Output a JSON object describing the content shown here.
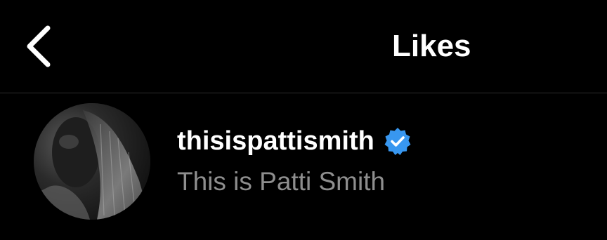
{
  "header": {
    "back_icon": "chevron-left-icon",
    "title": "Likes"
  },
  "likes": [
    {
      "username": "thisispattismith",
      "full_name": "This is Patti Smith",
      "verified": true,
      "verified_icon": "verified-badge-icon",
      "avatar": "avatar-photo"
    }
  ],
  "colors": {
    "background": "#000000",
    "primary_text": "#ffffff",
    "secondary_text": "#8e8e8e",
    "divider": "#2e2e2e",
    "verified_blue": "#3897f0"
  }
}
